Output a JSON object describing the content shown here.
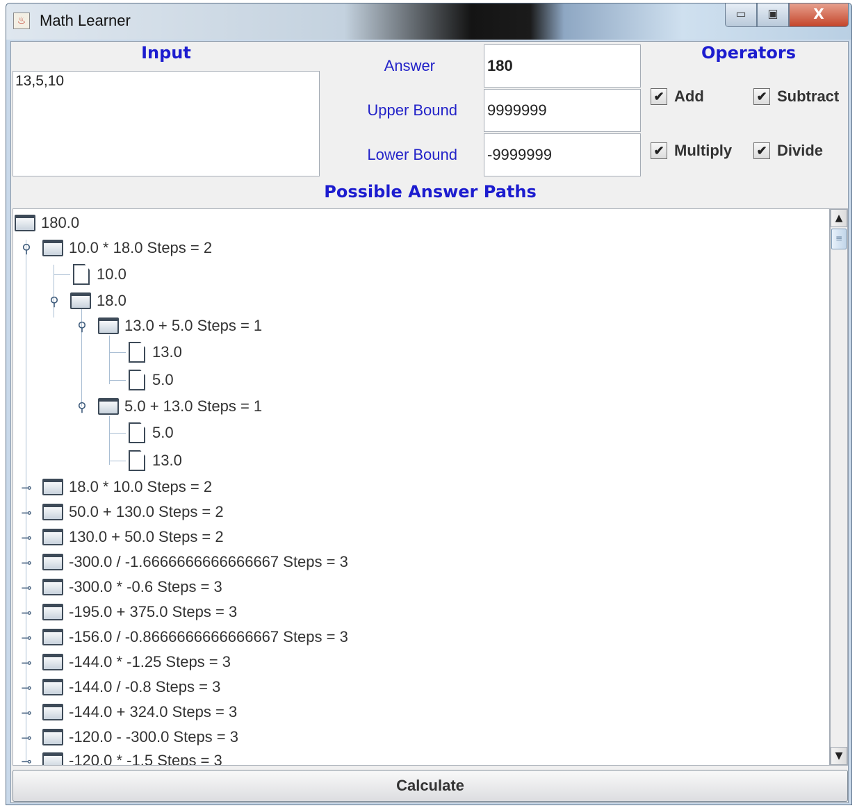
{
  "window": {
    "title": "Math Learner",
    "controls": {
      "minimize": "▭",
      "maximize": "▣",
      "close": "X"
    }
  },
  "input": {
    "heading": "Input",
    "value": "13,5,10"
  },
  "parameters": {
    "answer_label": "Answer",
    "answer_value": "180",
    "upper_label": "Upper Bound",
    "upper_value": "9999999",
    "lower_label": "Lower Bound",
    "lower_value": "-9999999"
  },
  "operators": {
    "heading": "Operators",
    "items": [
      {
        "label": "Add",
        "checked": true
      },
      {
        "label": "Subtract",
        "checked": true
      },
      {
        "label": "Multiply",
        "checked": true
      },
      {
        "label": "Divide",
        "checked": true
      }
    ]
  },
  "paths": {
    "heading": "Possible Answer Paths",
    "root": "180.0",
    "nodes": [
      "10.0 * 18.0 Steps = 2",
      "10.0",
      "18.0",
      "13.0 + 5.0 Steps = 1",
      "13.0",
      "5.0",
      "5.0 + 13.0 Steps = 1",
      "5.0",
      "13.0",
      "18.0 * 10.0 Steps = 2",
      "50.0 + 130.0 Steps = 2",
      "130.0 + 50.0 Steps = 2",
      "-300.0 / -1.6666666666666667 Steps = 3",
      "-300.0 * -0.6 Steps = 3",
      "-195.0 + 375.0 Steps = 3",
      "-156.0 / -0.8666666666666667 Steps = 3",
      "-144.0 * -1.25 Steps = 3",
      "-144.0 / -0.8 Steps = 3",
      "-144.0 + 324.0 Steps = 3",
      "-120.0 - -300.0 Steps = 3",
      "-120.0 * -1.5 Steps = 3"
    ]
  },
  "scrollbar": {
    "up": "▲",
    "down": "▼",
    "grip": "≡"
  },
  "calculate_label": "Calculate"
}
